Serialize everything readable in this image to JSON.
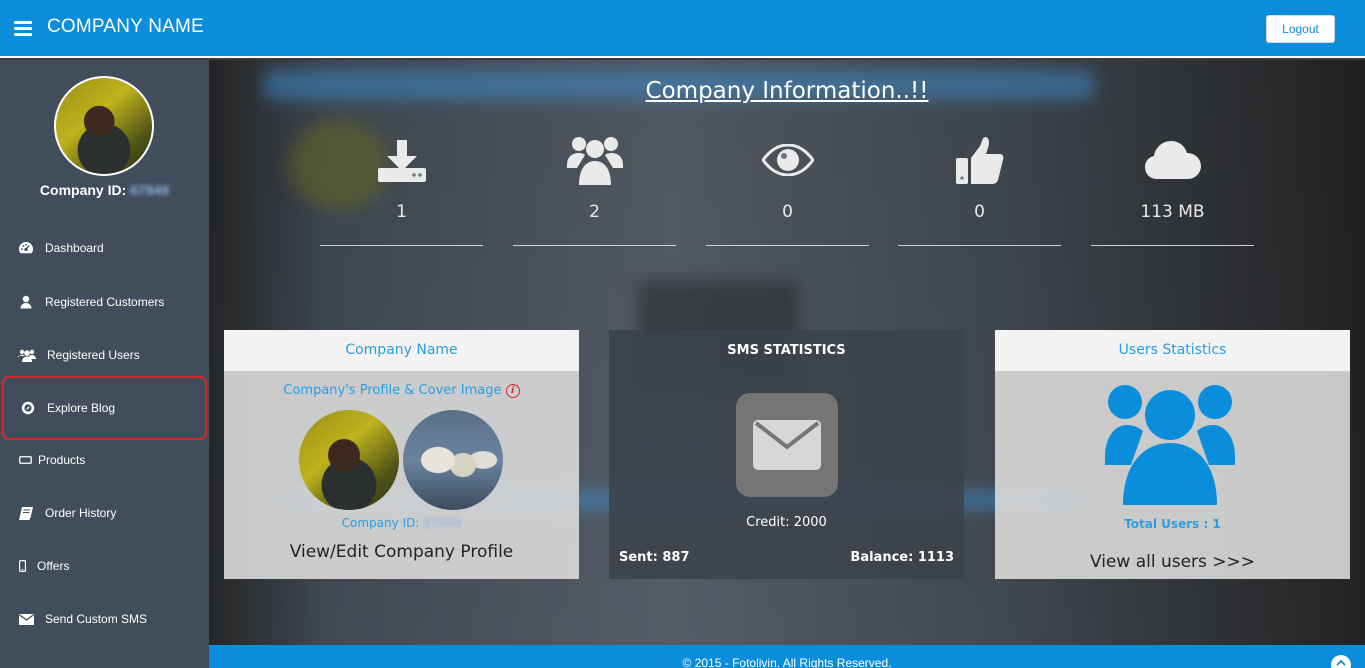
{
  "header": {
    "brand": "COMPANY NAME",
    "logout_label": "Logout"
  },
  "sidebar": {
    "company_id_label": "Company ID:",
    "company_id_value": "67849",
    "items": [
      {
        "label": "Dashboard",
        "icon": "dashboard-icon"
      },
      {
        "label": "Registered Customers",
        "icon": "user-icon"
      },
      {
        "label": "Registered Users",
        "icon": "users-icon"
      },
      {
        "label": "Explore Blog",
        "icon": "compass-icon"
      },
      {
        "label": "Products",
        "icon": "product-icon"
      },
      {
        "label": "Order History",
        "icon": "book-icon"
      },
      {
        "label": "Offers",
        "icon": "mobile-icon"
      },
      {
        "label": "Send Custom SMS",
        "icon": "envelope-icon"
      }
    ]
  },
  "main": {
    "title": "Company Information..!!",
    "stats": [
      {
        "icon": "download-icon",
        "value": "1"
      },
      {
        "icon": "users-icon",
        "value": "2"
      },
      {
        "icon": "eye-icon",
        "value": "0"
      },
      {
        "icon": "thumbs-up-icon",
        "value": "0"
      },
      {
        "icon": "cloud-icon",
        "value": "113 MB"
      }
    ],
    "company_card": {
      "heading": "Company Name",
      "profile_link": "Company's Profile & Cover Image",
      "info_glyph": "i",
      "id_label": "Company ID:",
      "id_value": "67849",
      "action": "View/Edit Company Profile"
    },
    "sms_card": {
      "heading": "SMS STATISTICS",
      "credit": "Credit: 2000",
      "sent": "Sent: 887",
      "balance": "Balance: 1113"
    },
    "users_card": {
      "heading": "Users Statistics",
      "total": "Total Users : 1",
      "action": "View all users >>>"
    }
  },
  "footer": {
    "text": "© 2015 - Fotolivin. All Rights Reserved."
  },
  "colors": {
    "primary": "#0a8edb",
    "sidebar": "#424d5c",
    "accent_blue": "#2a9ee0",
    "highlight": "#d9262d"
  }
}
